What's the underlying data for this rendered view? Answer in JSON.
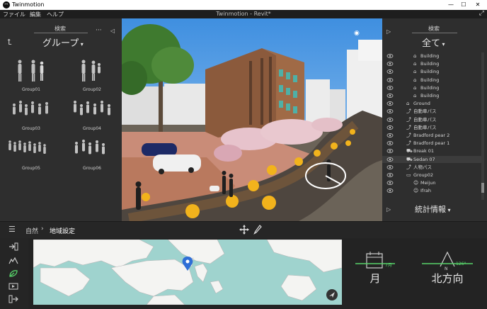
{
  "window": {
    "app_title": "Twinmotion",
    "document_title": "Twinmotion - Revit*",
    "logo_glyph": "ꟷ",
    "minimize": "—",
    "maximize": "☐",
    "close": "✕"
  },
  "menu": {
    "file": "ファイル",
    "edit": "編集",
    "help": "ヘルプ",
    "expand_icon": "⤢"
  },
  "library": {
    "search_label": "検索",
    "back_icon": "⮤",
    "more_icon": "···",
    "collapse_icon": "◁",
    "category": "グループ",
    "groups": [
      "Group01",
      "Group02",
      "Group03",
      "Group04",
      "Group05",
      "Group06"
    ]
  },
  "scene": {
    "search_label": "検索",
    "filter": "全て",
    "expand_icon": "▷",
    "rows": [
      {
        "icon": "building-icon",
        "glyph": "⌂",
        "label": "Building",
        "indent": 1
      },
      {
        "icon": "building-icon",
        "glyph": "⌂",
        "label": "Building",
        "indent": 1
      },
      {
        "icon": "building-icon",
        "glyph": "⌂",
        "label": "Building",
        "indent": 1
      },
      {
        "icon": "building-icon",
        "glyph": "⌂",
        "label": "Building",
        "indent": 1
      },
      {
        "icon": "building-icon",
        "glyph": "⌂",
        "label": "Building",
        "indent": 1
      },
      {
        "icon": "building-icon",
        "glyph": "⌂",
        "label": "Building",
        "indent": 1
      },
      {
        "icon": "ground-icon",
        "glyph": "⌂",
        "label": "Ground",
        "indent": 0
      },
      {
        "icon": "path-icon",
        "glyph": "⤴",
        "label": "自動車パス",
        "indent": 0
      },
      {
        "icon": "path-icon",
        "glyph": "⤴",
        "label": "自動車パス",
        "indent": 0
      },
      {
        "icon": "path-icon",
        "glyph": "⤴",
        "label": "自動車パス",
        "indent": 0
      },
      {
        "icon": "path-icon",
        "glyph": "⤴",
        "label": "Bradford pear 2",
        "indent": 0
      },
      {
        "icon": "path-icon",
        "glyph": "⤴",
        "label": "Bradford pear 1",
        "indent": 0
      },
      {
        "icon": "car-icon",
        "glyph": "⛟",
        "label": "Break 01",
        "indent": 0
      },
      {
        "icon": "car-icon",
        "glyph": "⛟",
        "label": "Sedan 07",
        "indent": 0
      },
      {
        "icon": "path-icon",
        "glyph": "⤴",
        "label": "人物パス",
        "indent": 0
      },
      {
        "icon": "folder-icon",
        "glyph": "▭",
        "label": "Group02",
        "indent": 0
      },
      {
        "icon": "person-icon",
        "glyph": "☺",
        "label": "Meijun",
        "indent": 1
      },
      {
        "icon": "person-icon",
        "glyph": "☺",
        "label": "Ifrah",
        "indent": 1
      }
    ],
    "selected_index": 13,
    "stats_icon": "▷",
    "stats_label": "統計情報"
  },
  "breadcrumb": {
    "menu_icon": "☰",
    "parent": "自然",
    "separator": "›",
    "current": "地域設定"
  },
  "viewport": {
    "eye_icon": "◉"
  },
  "location": {
    "month_label": "月",
    "month_value": "7月",
    "direction_label": "北方向",
    "direction_value": "126°",
    "north_letter": "N"
  },
  "colors": {
    "accent": "#57d36a",
    "panel": "#2e2e2e",
    "water": "#9fd3ce",
    "land": "#f4f4f2",
    "marker": "#2f6fd6"
  }
}
